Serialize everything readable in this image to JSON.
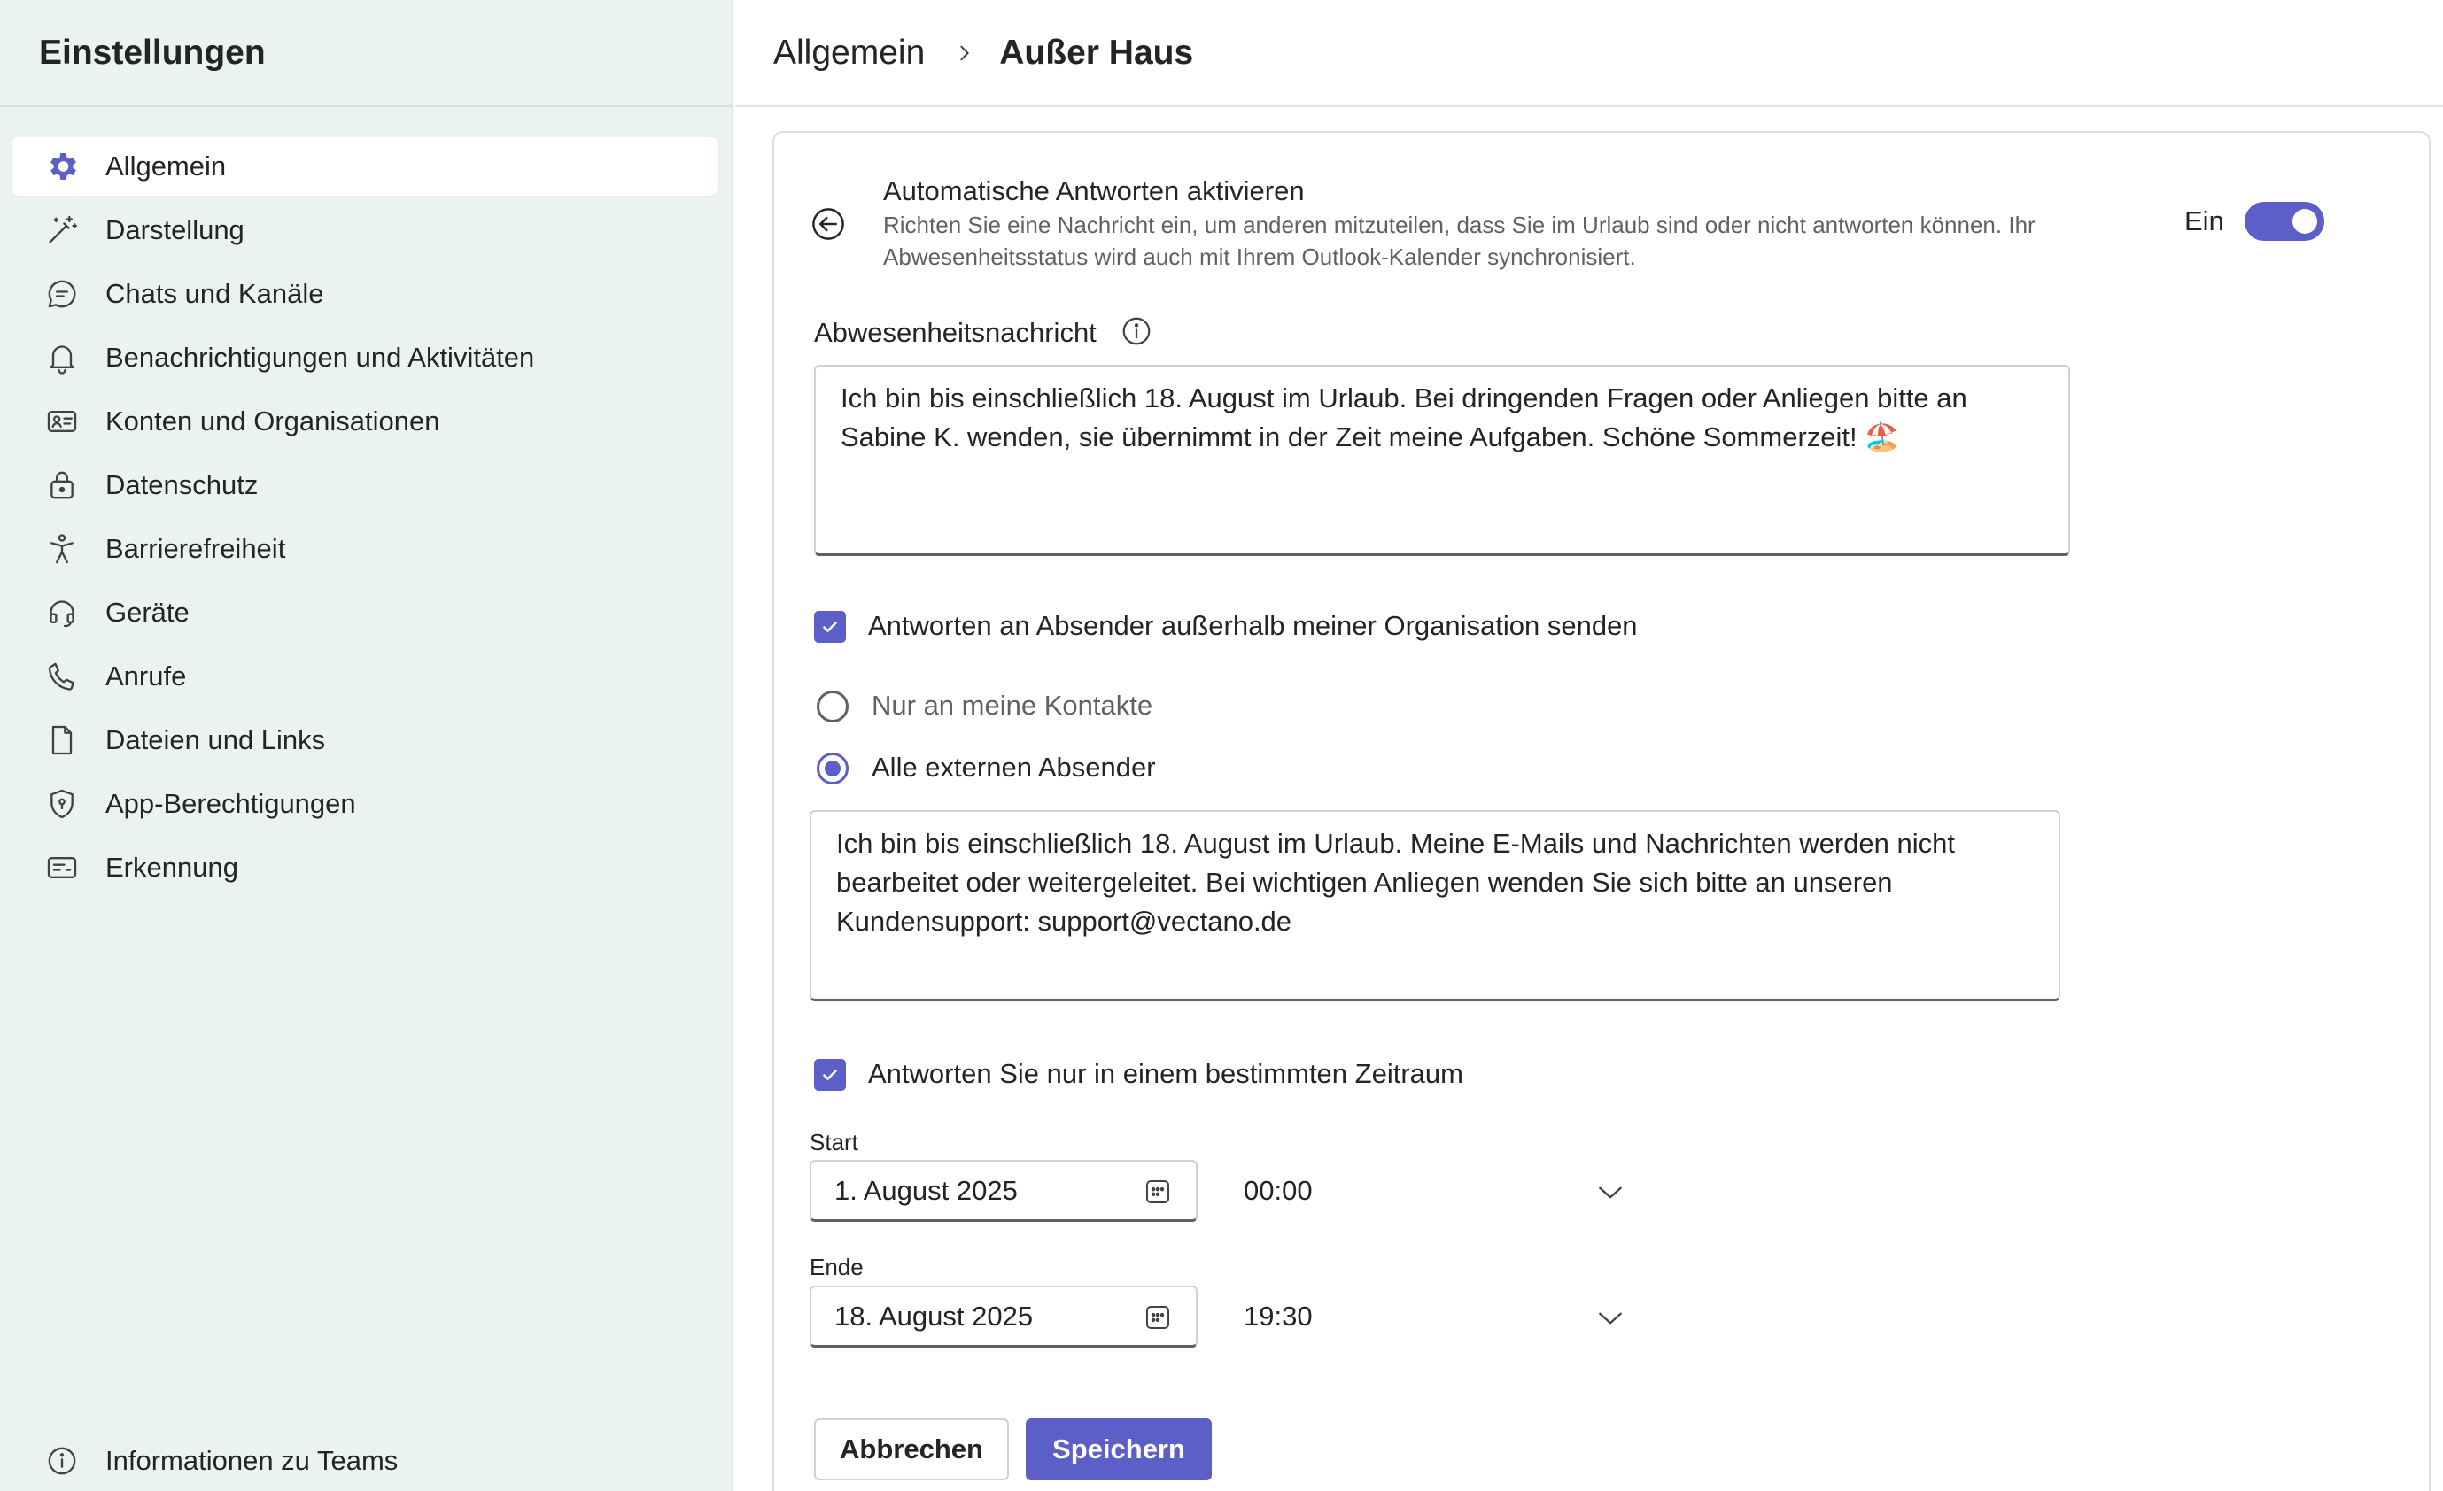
{
  "sidebar": {
    "title": "Einstellungen",
    "items": [
      {
        "label": "Allgemein",
        "icon": "gear-icon",
        "active": true
      },
      {
        "label": "Darstellung",
        "icon": "magic-wand-icon"
      },
      {
        "label": "Chats und Kanäle",
        "icon": "chat-bubble-icon"
      },
      {
        "label": "Benachrichtigungen und Aktivitäten",
        "icon": "bell-icon"
      },
      {
        "label": "Konten und Organisationen",
        "icon": "id-card-icon"
      },
      {
        "label": "Datenschutz",
        "icon": "lock-icon"
      },
      {
        "label": "Barrierefreiheit",
        "icon": "accessibility-icon"
      },
      {
        "label": "Geräte",
        "icon": "headset-icon"
      },
      {
        "label": "Anrufe",
        "icon": "phone-icon"
      },
      {
        "label": "Dateien und Links",
        "icon": "document-icon"
      },
      {
        "label": "App-Berechtigungen",
        "icon": "shield-icon"
      },
      {
        "label": "Erkennung",
        "icon": "caption-icon"
      }
    ],
    "about": {
      "label": "Informationen zu Teams",
      "icon": "info-icon"
    }
  },
  "header": {
    "parent": "Allgemein",
    "current": "Außer Haus"
  },
  "auto_reply": {
    "title": "Automatische Antworten aktivieren",
    "description": "Richten Sie eine Nachricht ein, um anderen mitzuteilen, dass Sie im Urlaub sind oder nicht antworten können. Ihr Abwesenheitsstatus wird auch mit Ihrem Outlook-Kalender synchronisiert.",
    "toggle_label": "Ein",
    "toggle_on": true
  },
  "message": {
    "label": "Abwesenheitsnachricht",
    "text": "Ich bin bis einschließlich 18. August im Urlaub. Bei dringenden Fragen oder Anliegen bitte an Sabine K. wenden, sie übernimmt in der Zeit meine Aufgaben. Schöne Sommerzeit! 🏖️"
  },
  "external": {
    "checkbox_label": "Antworten an Absender außerhalb meiner Organisation senden",
    "checked": true,
    "options": [
      {
        "label": "Nur an meine Kontakte",
        "selected": false
      },
      {
        "label": "Alle externen Absender",
        "selected": true
      }
    ],
    "text": "Ich bin bis einschließlich 18. August im Urlaub. Meine E-Mails und Nachrichten werden nicht bearbeitet oder weitergeleitet. Bei wichtigen Anliegen wenden Sie sich bitte an unseren Kundensupport: support@vectano.de"
  },
  "schedule": {
    "checkbox_label": "Antworten Sie nur in einem bestimmten Zeitraum",
    "checked": true,
    "start": {
      "label": "Start",
      "date": "1. August 2025",
      "time": "00:00"
    },
    "end": {
      "label": "Ende",
      "date": "18. August 2025",
      "time": "19:30"
    }
  },
  "actions": {
    "cancel": "Abbrechen",
    "save": "Speichern"
  },
  "colors": {
    "accent": "#5b5fc7",
    "sidebar_bg": "#ebf3f2"
  }
}
